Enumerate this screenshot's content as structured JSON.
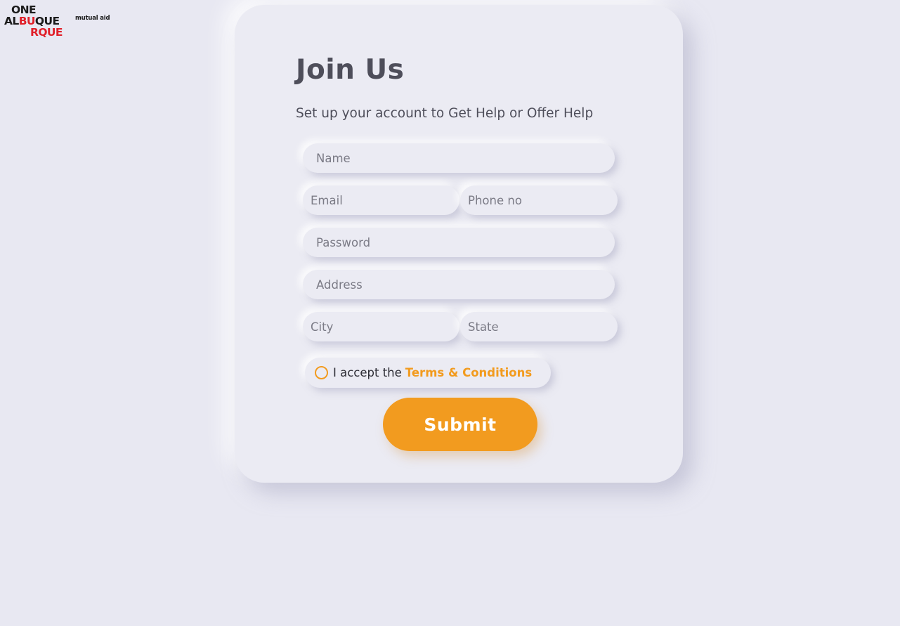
{
  "logo": {
    "line1": "ONE",
    "line2_a": "AL",
    "line2_b": "BU",
    "line2_c": "QUE",
    "line3": "RQUE",
    "tagline": "mutual aid"
  },
  "form": {
    "title": "Join Us",
    "subtitle": "Set up your account to Get Help or Offer Help",
    "fields": {
      "name": {
        "placeholder": "Name",
        "value": ""
      },
      "email": {
        "placeholder": "Email",
        "value": ""
      },
      "phone": {
        "placeholder": "Phone no",
        "value": ""
      },
      "password": {
        "placeholder": "Password",
        "value": ""
      },
      "address": {
        "placeholder": "Address",
        "value": ""
      },
      "city": {
        "placeholder": "City",
        "value": ""
      },
      "state": {
        "placeholder": "State",
        "value": ""
      }
    },
    "terms": {
      "prefix": "I accept the",
      "link": "Terms & Conditions",
      "checked": false
    },
    "submit_label": "Submit"
  },
  "colors": {
    "background": "#e8e8f2",
    "accent": "#f29b1f",
    "text": "#4e4e5a",
    "logo_red": "#e0202a"
  }
}
